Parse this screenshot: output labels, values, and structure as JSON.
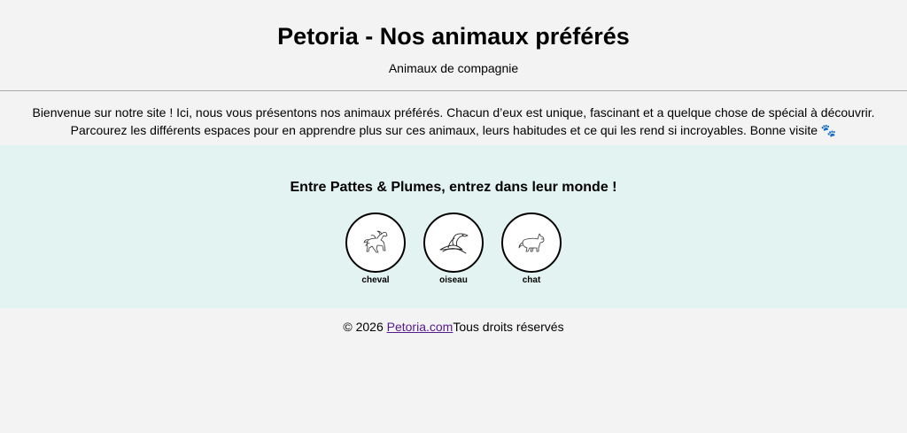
{
  "header": {
    "title": "Petoria - Nos animaux préférés",
    "subtitle": "Animaux de compagnie"
  },
  "intro": {
    "text": "Bienvenue sur notre site ! Ici, nous vous présentons nos animaux préférés. Chacun d’eux est unique, fascinant et a quelque chose de spécial à découvrir. Parcourez les différents espaces pour en apprendre plus sur ces animaux, leurs habitudes et ce qui les rend si incroyables. Bonne visite 🐾"
  },
  "animals_section": {
    "title": "Entre Pattes & Plumes, entrez dans leur monde !",
    "background_color": "#e3f3f1",
    "items": [
      {
        "label": "cheval",
        "icon": "horse-icon"
      },
      {
        "label": "oiseau",
        "icon": "bird-icon"
      },
      {
        "label": "chat",
        "icon": "cat-icon"
      }
    ]
  },
  "footer": {
    "copyright": "© 2026 ",
    "link_text": "Petoria.com",
    "rights": "Tous droits réservés",
    "link_color": "#551a8b"
  }
}
